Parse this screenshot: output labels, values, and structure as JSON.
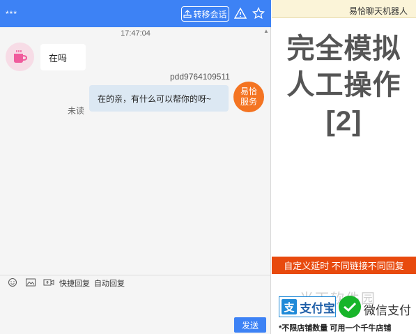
{
  "chat": {
    "title": "***",
    "transfer_button": "转移会话",
    "timestamp": "17:47:04",
    "incoming_message": "在吗",
    "sender_name": "pdd9764109511",
    "outgoing_message": "在的亲，有什么可以帮你的呀~",
    "unread_label": "未读",
    "service_avatar": {
      "line1": "易恰",
      "line2": "服务"
    },
    "toolbar": {
      "quick_reply": "快捷回复",
      "auto_reply": "自动回复"
    },
    "send_button": "发送",
    "accent_color": "#3d82f5"
  },
  "promo": {
    "header": "易恰聊天机器人",
    "headline": {
      "line1": "完全模拟",
      "line2": "人工操作",
      "line3": "[2]"
    },
    "banner": "自定义延时 不同链接不同回复",
    "alipay": {
      "mark": "支",
      "label": "支付宝"
    },
    "wechat_pay": "微信支付",
    "watermark": "当下软件园",
    "footer": "*不限店铺数量 可用一个千牛店铺",
    "banner_color": "#e84a0e"
  }
}
